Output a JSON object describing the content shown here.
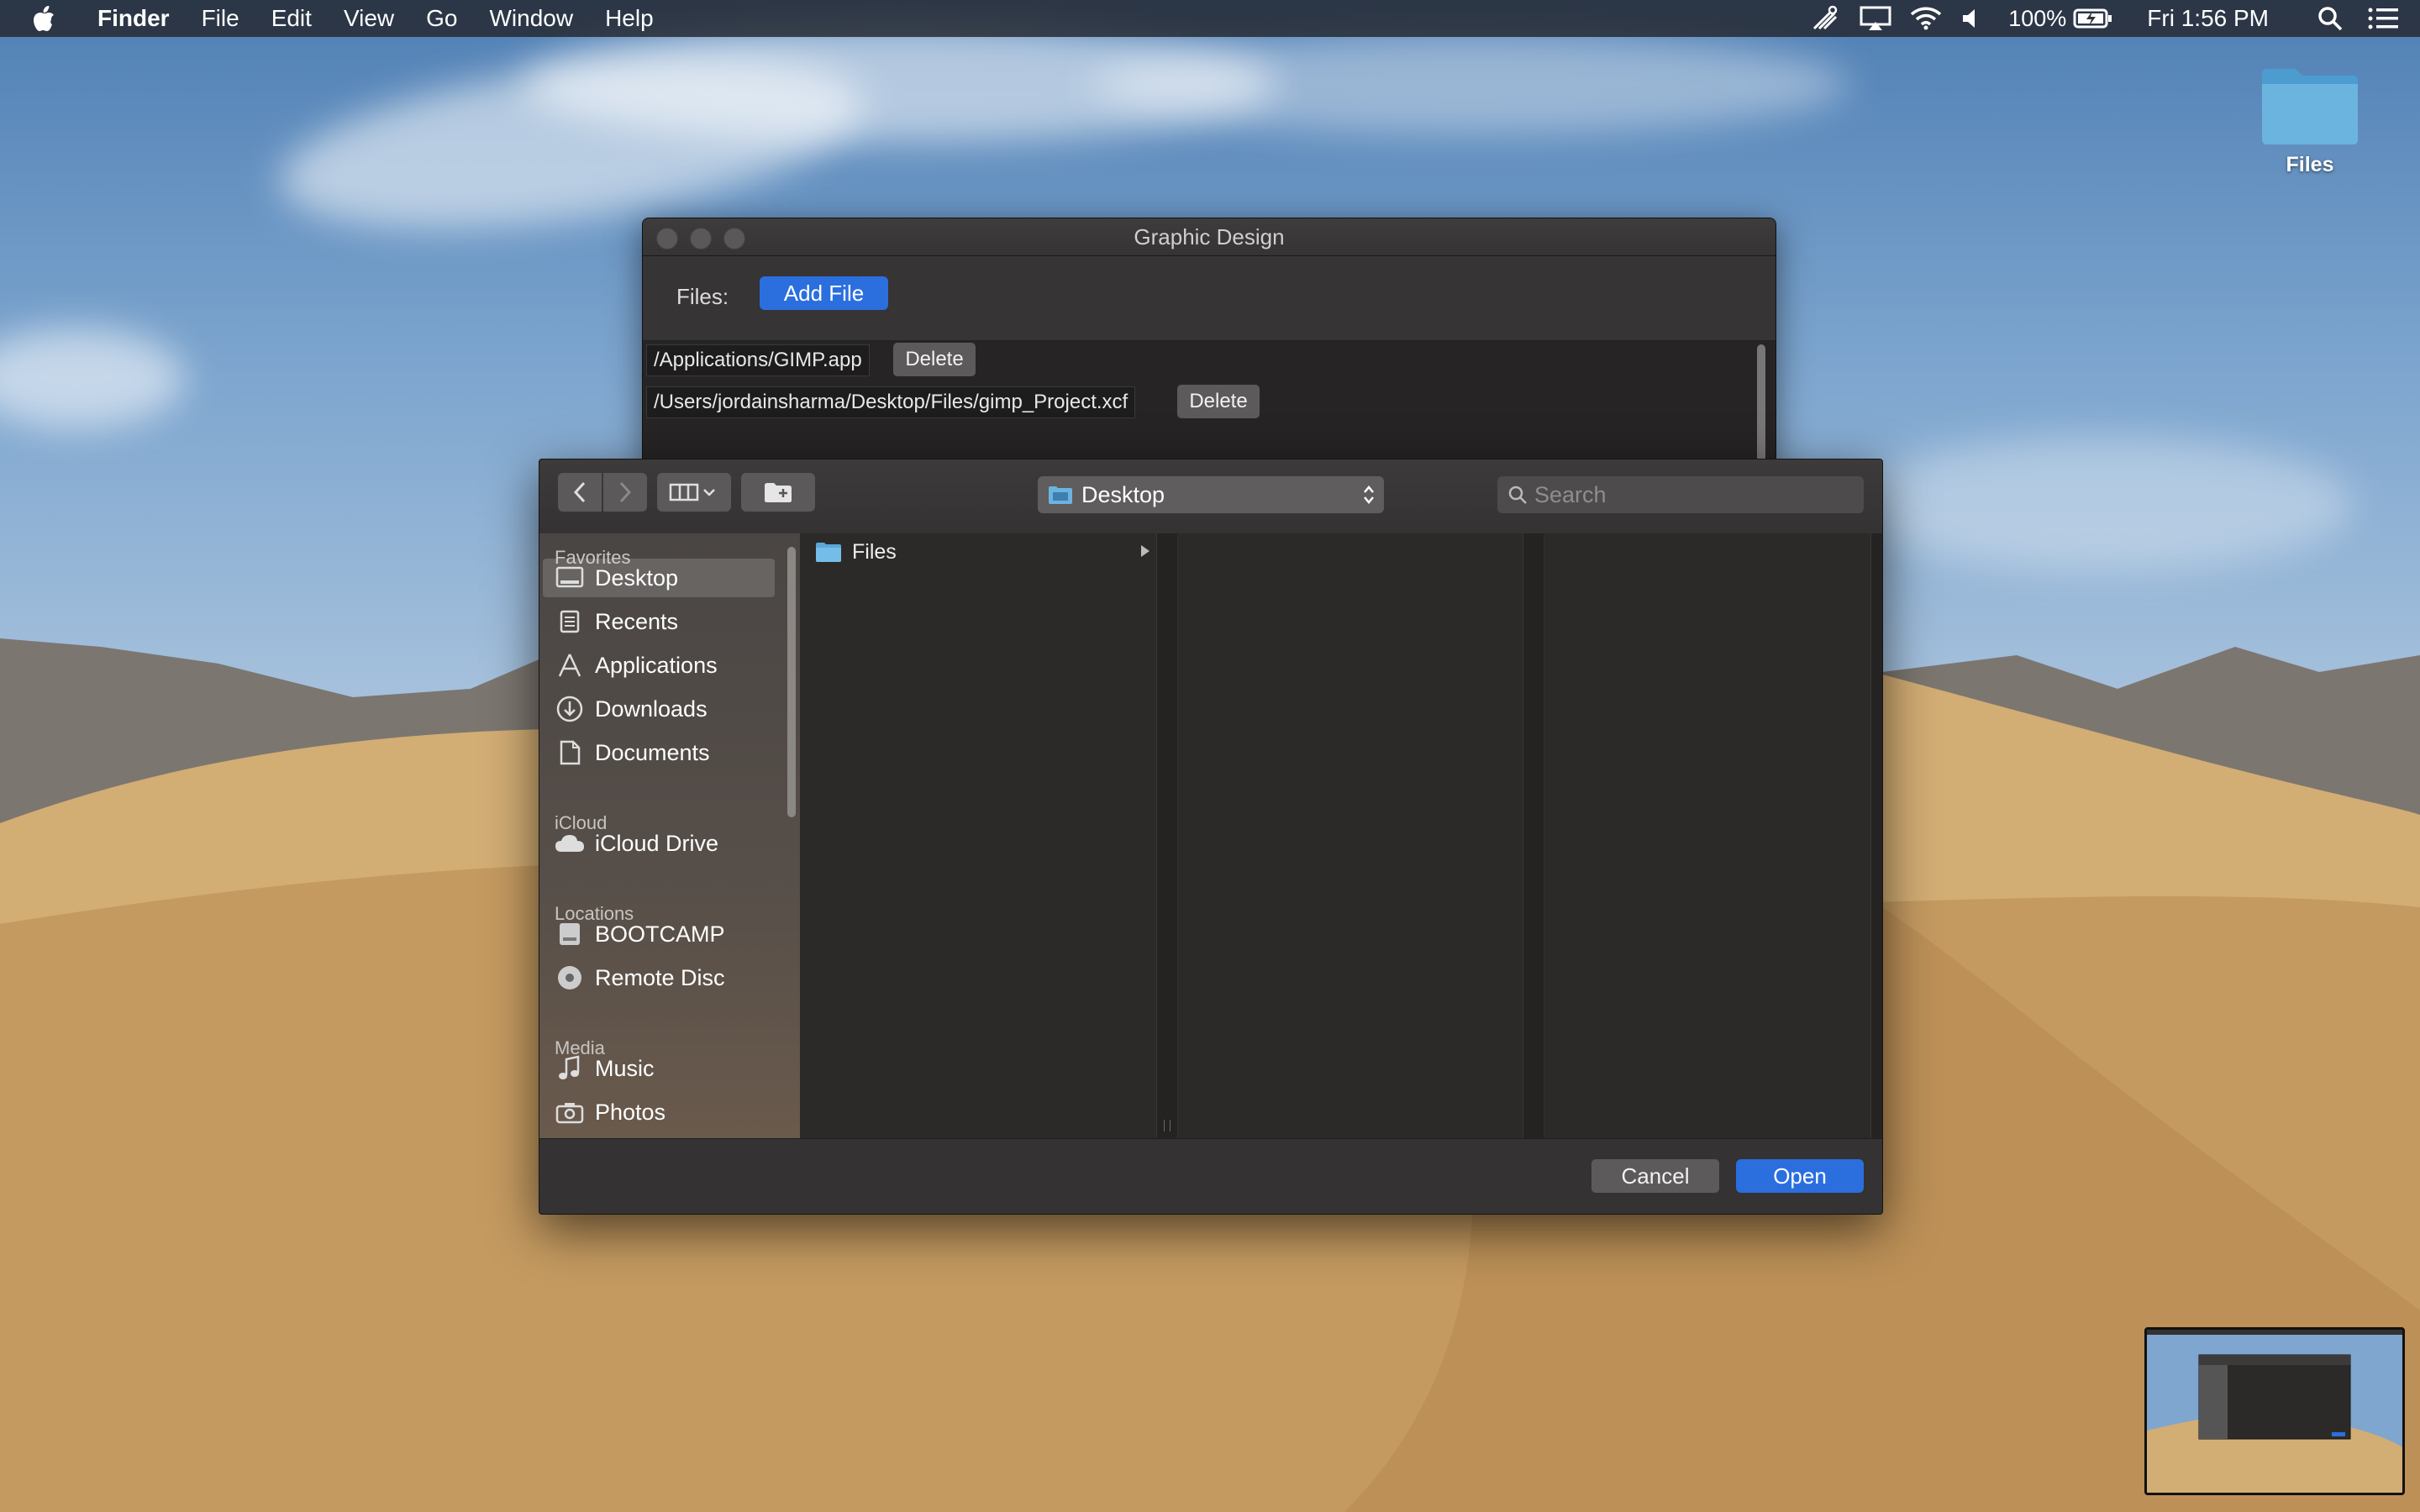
{
  "menubar": {
    "app_name": "Finder",
    "menus": [
      "File",
      "Edit",
      "View",
      "Go",
      "Window",
      "Help"
    ],
    "battery": "100%",
    "clock": "Fri 1:56 PM"
  },
  "desktop": {
    "icons": [
      {
        "label": "Files",
        "icon": "folder-icon"
      }
    ]
  },
  "graphic_design_window": {
    "title": "Graphic Design",
    "files_label": "Files:",
    "add_file_label": "Add File",
    "entries": [
      {
        "path": "/Applications/GIMP.app",
        "delete_label": "Delete"
      },
      {
        "path": "/Users/jordainsharma/Desktop/Files/gimp_Project.xcf",
        "delete_label": "Delete"
      }
    ]
  },
  "open_dialog": {
    "location": "Desktop",
    "search_placeholder": "Search",
    "sidebar": {
      "sections": [
        {
          "title": "Favorites",
          "items": [
            {
              "label": "Desktop",
              "icon": "desktop-icon",
              "selected": true
            },
            {
              "label": "Recents",
              "icon": "recents-icon"
            },
            {
              "label": "Applications",
              "icon": "applications-icon"
            },
            {
              "label": "Downloads",
              "icon": "downloads-icon"
            },
            {
              "label": "Documents",
              "icon": "documents-icon"
            }
          ]
        },
        {
          "title": "iCloud",
          "items": [
            {
              "label": "iCloud Drive",
              "icon": "cloud-icon"
            }
          ]
        },
        {
          "title": "Locations",
          "items": [
            {
              "label": "BOOTCAMP",
              "icon": "disk-icon"
            },
            {
              "label": "Remote Disc",
              "icon": "disc-icon"
            }
          ]
        },
        {
          "title": "Media",
          "items": [
            {
              "label": "Music",
              "icon": "music-icon"
            },
            {
              "label": "Photos",
              "icon": "camera-icon"
            }
          ]
        }
      ]
    },
    "column1": [
      {
        "label": "Files",
        "icon": "folder-icon",
        "has_children": true
      }
    ],
    "cancel_label": "Cancel",
    "open_label": "Open"
  },
  "colors": {
    "accent": "#2b6ede",
    "folder": "#6cb4e0",
    "dialog_bg": "#323030"
  }
}
